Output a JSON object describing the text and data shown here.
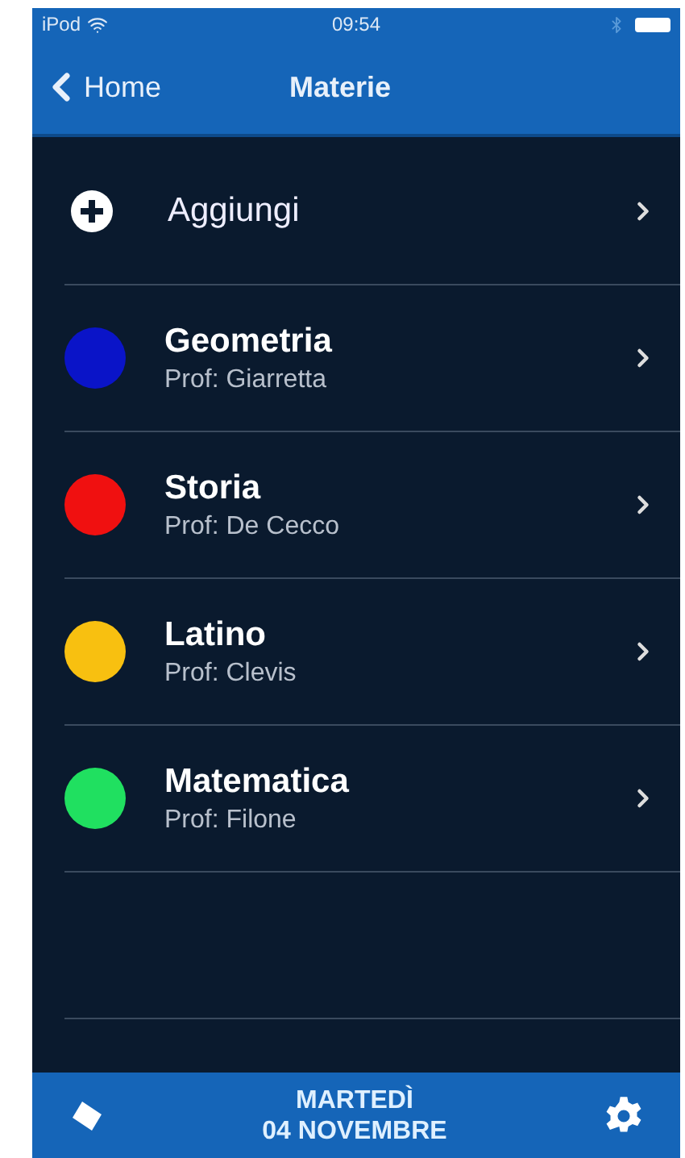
{
  "status_bar": {
    "carrier": "iPod",
    "time": "09:54"
  },
  "nav_bar": {
    "back": "Home",
    "title": "Materie"
  },
  "add_row": {
    "label": "Aggiungi"
  },
  "subjects": [
    {
      "name": "Geometria",
      "teacher": "Prof: Giarretta",
      "color": "#0a14c8"
    },
    {
      "name": "Storia",
      "teacher": "Prof: De Cecco",
      "color": "#f01010"
    },
    {
      "name": "Latino",
      "teacher": "Prof: Clevis",
      "color": "#f8c010"
    },
    {
      "name": "Matematica",
      "teacher": "Prof: Filone",
      "color": "#20e060"
    }
  ],
  "bottom_bar": {
    "day": "MARTEDÌ",
    "date": "04 NOVEMBRE"
  }
}
